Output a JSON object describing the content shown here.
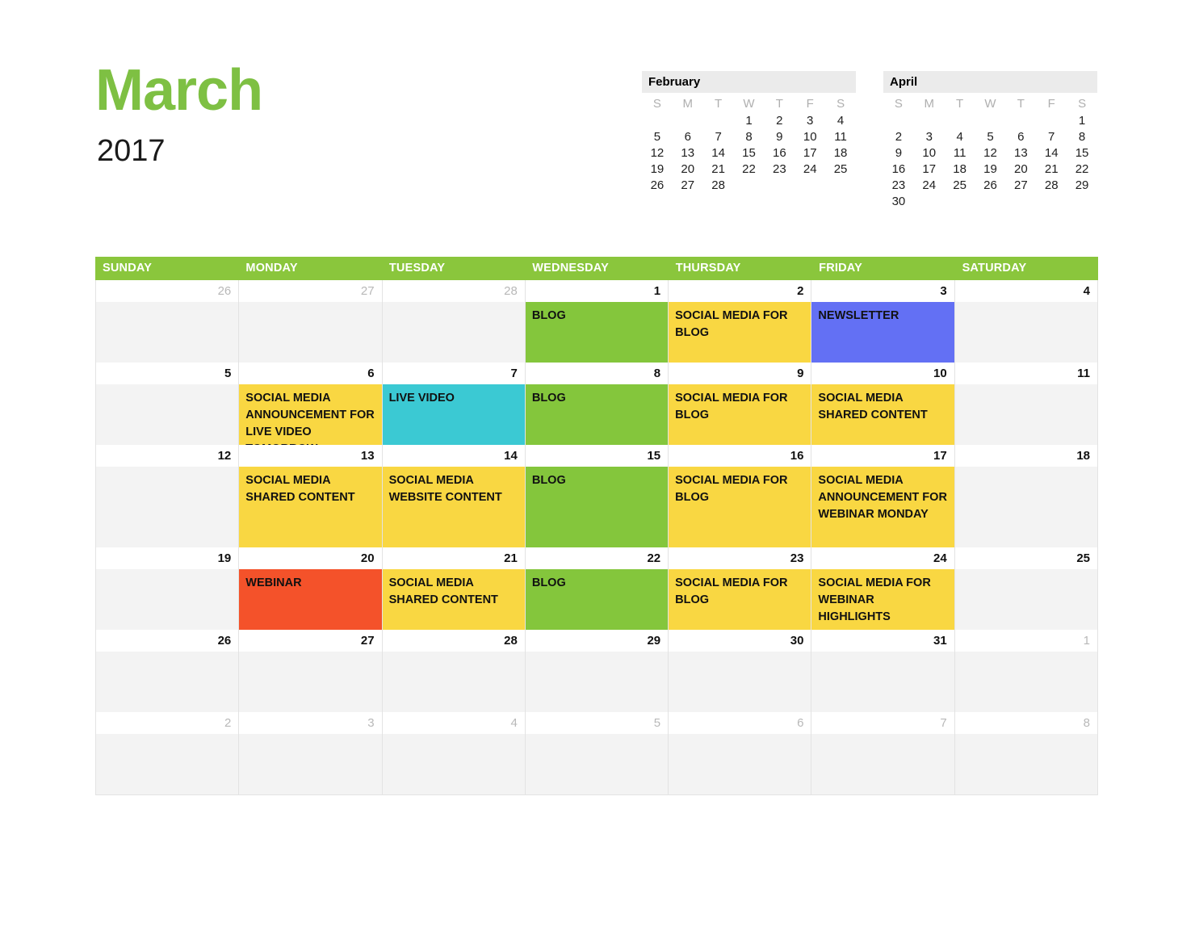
{
  "title": {
    "month": "March",
    "year": "2017"
  },
  "mini_calendars": [
    {
      "name": "February",
      "dow": [
        "S",
        "M",
        "T",
        "W",
        "T",
        "F",
        "S"
      ],
      "leading_blanks": 3,
      "days": [
        1,
        2,
        3,
        4,
        5,
        6,
        7,
        8,
        9,
        10,
        11,
        12,
        13,
        14,
        15,
        16,
        17,
        18,
        19,
        20,
        21,
        22,
        23,
        24,
        25,
        26,
        27,
        28
      ]
    },
    {
      "name": "April",
      "dow": [
        "S",
        "M",
        "T",
        "W",
        "T",
        "F",
        "S"
      ],
      "leading_blanks": 6,
      "days": [
        1,
        2,
        3,
        4,
        5,
        6,
        7,
        8,
        9,
        10,
        11,
        12,
        13,
        14,
        15,
        16,
        17,
        18,
        19,
        20,
        21,
        22,
        23,
        24,
        25,
        26,
        27,
        28,
        29,
        30
      ]
    }
  ],
  "calendar": {
    "weekday_headers": [
      "SUNDAY",
      "MONDAY",
      "TUESDAY",
      "WEDNESDAY",
      "THURSDAY",
      "FRIDAY",
      "SATURDAY"
    ],
    "colors": {
      "header_green": "#8AC63C",
      "blog_green": "#84C63C",
      "social_yellow": "#F9D742",
      "newsletter_blue": "#6370F4",
      "live_video_cyan": "#3BC9D3",
      "webinar_red": "#F4522A",
      "empty_gray": "#F3F3F3",
      "title_green": "#7EC043"
    },
    "weeks": [
      {
        "band": "normal",
        "days": [
          {
            "date": "26",
            "other_month": true,
            "event": "",
            "color": "e-none"
          },
          {
            "date": "27",
            "other_month": true,
            "event": "",
            "color": "e-none"
          },
          {
            "date": "28",
            "other_month": true,
            "event": "",
            "color": "e-none"
          },
          {
            "date": "1",
            "other_month": false,
            "event": "BLOG",
            "color": "e-green"
          },
          {
            "date": "2",
            "other_month": false,
            "event": "SOCIAL MEDIA FOR BLOG",
            "color": "e-yellow"
          },
          {
            "date": "3",
            "other_month": false,
            "event": "NEWSLETTER",
            "color": "e-blue"
          },
          {
            "date": "4",
            "other_month": false,
            "event": "",
            "color": "e-none"
          }
        ]
      },
      {
        "band": "normal",
        "days": [
          {
            "date": "5",
            "other_month": false,
            "event": "",
            "color": "e-none"
          },
          {
            "date": "6",
            "other_month": false,
            "event": "SOCIAL MEDIA ANNOUNCEMENT FOR LIVE VIDEO TOMORROW",
            "color": "e-yellow"
          },
          {
            "date": "7",
            "other_month": false,
            "event": "LIVE VIDEO",
            "color": "e-cyan"
          },
          {
            "date": "8",
            "other_month": false,
            "event": "BLOG",
            "color": "e-green"
          },
          {
            "date": "9",
            "other_month": false,
            "event": "SOCIAL MEDIA FOR BLOG",
            "color": "e-yellow"
          },
          {
            "date": "10",
            "other_month": false,
            "event": "SOCIAL MEDIA SHARED CONTENT",
            "color": "e-yellow"
          },
          {
            "date": "11",
            "other_month": false,
            "event": "",
            "color": "e-none"
          }
        ]
      },
      {
        "band": "tall",
        "days": [
          {
            "date": "12",
            "other_month": false,
            "event": "",
            "color": "e-none"
          },
          {
            "date": "13",
            "other_month": false,
            "event": "SOCIAL MEDIA SHARED CONTENT",
            "color": "e-yellow"
          },
          {
            "date": "14",
            "other_month": false,
            "event": "SOCIAL MEDIA WEBSITE CONTENT",
            "color": "e-yellow"
          },
          {
            "date": "15",
            "other_month": false,
            "event": "BLOG",
            "color": "e-green"
          },
          {
            "date": "16",
            "other_month": false,
            "event": "SOCIAL MEDIA FOR BLOG",
            "color": "e-yellow"
          },
          {
            "date": "17",
            "other_month": false,
            "event": "SOCIAL MEDIA ANNOUNCEMENT FOR WEBINAR MONDAY",
            "color": "e-yellow"
          },
          {
            "date": "18",
            "other_month": false,
            "event": "",
            "color": "e-none"
          }
        ]
      },
      {
        "band": "normal",
        "days": [
          {
            "date": "19",
            "other_month": false,
            "event": "",
            "color": "e-none"
          },
          {
            "date": "20",
            "other_month": false,
            "event": "WEBINAR",
            "color": "e-red"
          },
          {
            "date": "21",
            "other_month": false,
            "event": "SOCIAL MEDIA SHARED CONTENT",
            "color": "e-yellow"
          },
          {
            "date": "22",
            "other_month": false,
            "event": "BLOG",
            "color": "e-green"
          },
          {
            "date": "23",
            "other_month": false,
            "event": "SOCIAL MEDIA FOR BLOG",
            "color": "e-yellow"
          },
          {
            "date": "24",
            "other_month": false,
            "event": "SOCIAL MEDIA FOR WEBINAR HIGHLIGHTS",
            "color": "e-yellow"
          },
          {
            "date": "25",
            "other_month": false,
            "event": "",
            "color": "e-none"
          }
        ]
      },
      {
        "band": "normal",
        "days": [
          {
            "date": "26",
            "other_month": false,
            "event": "",
            "color": "e-none"
          },
          {
            "date": "27",
            "other_month": false,
            "event": "",
            "color": "e-none"
          },
          {
            "date": "28",
            "other_month": false,
            "event": "",
            "color": "e-none"
          },
          {
            "date": "29",
            "other_month": false,
            "event": "",
            "color": "e-none"
          },
          {
            "date": "30",
            "other_month": false,
            "event": "",
            "color": "e-none"
          },
          {
            "date": "31",
            "other_month": false,
            "event": "",
            "color": "e-none"
          },
          {
            "date": "1",
            "other_month": true,
            "event": "",
            "color": "e-none"
          }
        ]
      },
      {
        "band": "normal",
        "days": [
          {
            "date": "2",
            "other_month": true,
            "event": "",
            "color": "e-none"
          },
          {
            "date": "3",
            "other_month": true,
            "event": "",
            "color": "e-none"
          },
          {
            "date": "4",
            "other_month": true,
            "event": "",
            "color": "e-none"
          },
          {
            "date": "5",
            "other_month": true,
            "event": "",
            "color": "e-none"
          },
          {
            "date": "6",
            "other_month": true,
            "event": "",
            "color": "e-none"
          },
          {
            "date": "7",
            "other_month": true,
            "event": "",
            "color": "e-none"
          },
          {
            "date": "8",
            "other_month": true,
            "event": "",
            "color": "e-none"
          }
        ]
      }
    ]
  }
}
